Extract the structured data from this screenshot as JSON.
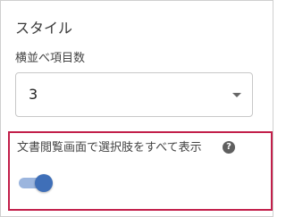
{
  "section": {
    "title": "スタイル"
  },
  "columns_field": {
    "label": "横並べ項目数",
    "value": "3"
  },
  "display_option": {
    "label": "文書閲覧画面で選択肢をすべて表示",
    "help_icon": "question-circle-icon",
    "help_glyph": "?",
    "enabled": true
  },
  "colors": {
    "toggle_thumb": "#3f6fb8",
    "toggle_track": "#9bb5de",
    "highlight_border": "#c21f4a"
  }
}
